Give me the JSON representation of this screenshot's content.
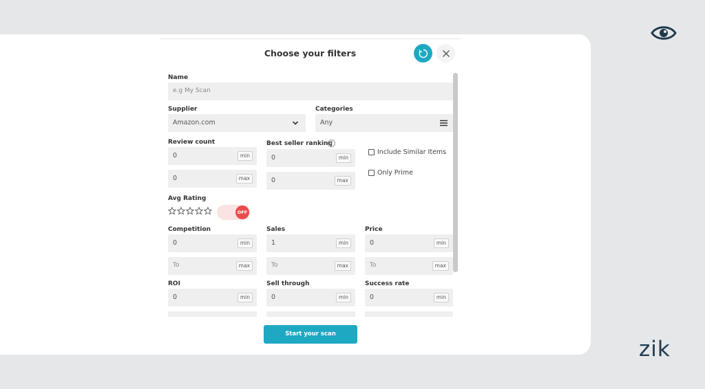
{
  "dialog": {
    "title": "Choose your filters",
    "start_button": "Start your scan"
  },
  "fields": {
    "name": {
      "label": "Name",
      "placeholder": "e.g My Scan"
    },
    "supplier": {
      "label": "Supplier",
      "value": "Amazon.com"
    },
    "categories": {
      "label": "Categories",
      "value": "Any"
    },
    "review_count": {
      "label": "Review count",
      "min_value": "0",
      "max_value": "0",
      "min_tag": "min",
      "max_tag": "max"
    },
    "best_seller_ranking": {
      "label": "Best seller ranking",
      "help": "?",
      "min_value": "0",
      "max_value": "0",
      "min_tag": "min",
      "max_tag": "max"
    },
    "include_similar": {
      "label": "Include Similar Items",
      "checked": false
    },
    "only_prime": {
      "label": "Only Prime",
      "checked": false
    },
    "avg_rating": {
      "label": "Avg Rating",
      "stars": 0,
      "toggle_label": "OFF"
    },
    "competition": {
      "label": "Competition",
      "min_value": "0",
      "max_placeholder": "To",
      "min_tag": "min",
      "max_tag": "max"
    },
    "sales": {
      "label": "Sales",
      "min_value": "1",
      "max_placeholder": "To",
      "min_tag": "min",
      "max_tag": "max"
    },
    "price": {
      "label": "Price",
      "min_value": "0",
      "max_placeholder": "To",
      "min_tag": "min",
      "max_tag": "max"
    },
    "roi": {
      "label": "ROI",
      "min_value": "0",
      "min_tag": "min"
    },
    "sell_through": {
      "label": "Sell through",
      "min_value": "0",
      "min_tag": "min"
    },
    "success_rate": {
      "label": "Success rate",
      "min_value": "0",
      "min_tag": "min"
    }
  },
  "brand": {
    "logo_text": "zik",
    "icon": "eye-icon",
    "colors": {
      "accent": "#1fa8c2",
      "off": "#e94c4c",
      "brand": "#1f3a4d"
    }
  }
}
